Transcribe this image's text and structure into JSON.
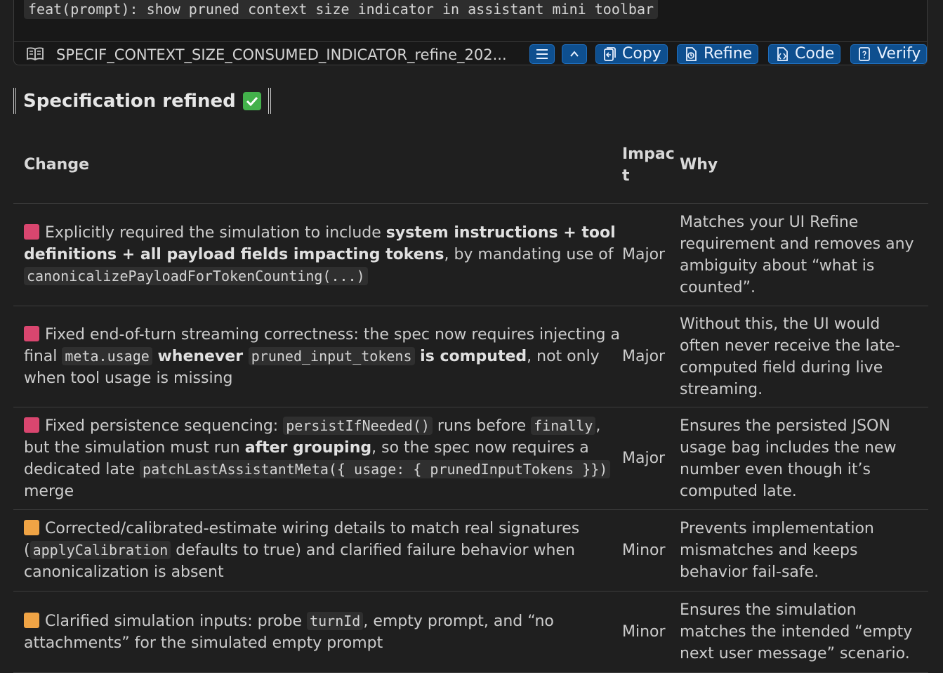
{
  "commit_message": "feat(prompt): show pruned context size indicator in assistant mini toolbar",
  "file": {
    "icon": "book-open-icon",
    "name": "SPECIF_CONTEXT_SIZE_CONSUMED_INDICATOR_refine_202..."
  },
  "toolbar": {
    "list_icon": "list-icon",
    "collapse_icon": "chevron-up-icon",
    "copy_label": "Copy",
    "refine_label": "Refine",
    "code_label": "Code",
    "verify_label": "Verify",
    "accent": "#0e4f8f"
  },
  "heading": {
    "text": "Specification refined",
    "emoji": "check-mark-button-icon"
  },
  "table": {
    "headers": {
      "change": "Change",
      "impact": "Impact",
      "why": "Why"
    },
    "colors": {
      "major": "#d9466f",
      "minor": "#f0a445"
    },
    "rows": [
      {
        "severity": "major",
        "change": {
          "t1": "Explicitly required the simulation to include ",
          "b1": "system instructions + tool definitions + all payload fields impacting tokens",
          "t2": ", by mandating use of ",
          "c1": "canonicalizePayloadForTokenCounting(...)"
        },
        "impact": "Major",
        "why": "Matches your UI Refine requirement and removes any ambiguity about “what is counted”."
      },
      {
        "severity": "major",
        "change": {
          "t1": "Fixed end-of-turn streaming correctness: the spec now requires injecting a final ",
          "c1": "meta.usage",
          "b1": " whenever ",
          "c2": "pruned_input_tokens",
          "b2": " is computed",
          "t2": ", not only when tool usage is missing"
        },
        "impact": "Major",
        "why": "Without this, the UI would often never receive the late-computed field during live streaming."
      },
      {
        "severity": "major",
        "change": {
          "t1": "Fixed persistence sequencing: ",
          "c1": "persistIfNeeded()",
          "t2": " runs before ",
          "c2": "finally",
          "t3": ", but the simulation must run ",
          "b1": "after grouping",
          "t4": ", so the spec now requires a dedicated late ",
          "c3": "patchLastAssistantMeta({ usage: { prunedInputTokens }})",
          "t5": " merge"
        },
        "impact": "Major",
        "why": "Ensures the persisted JSON usage bag includes the new number even though it’s computed late."
      },
      {
        "severity": "minor",
        "change": {
          "t1": "Corrected/calibrated-estimate wiring details to match real signatures (",
          "c1": "applyCalibration",
          "t2": " defaults to true) and clarified failure behavior when canonicalization is absent"
        },
        "impact": "Minor",
        "why": "Prevents implementation mismatches and keeps behavior fail-safe."
      },
      {
        "severity": "minor",
        "change": {
          "t1": "Clarified simulation inputs: probe ",
          "c1": "turnId",
          "t2": ", empty prompt, and “no attachments” for the simulated empty prompt"
        },
        "impact": "Minor",
        "why": "Ensures the simulation matches the intended “empty next user message” scenario."
      }
    ]
  }
}
